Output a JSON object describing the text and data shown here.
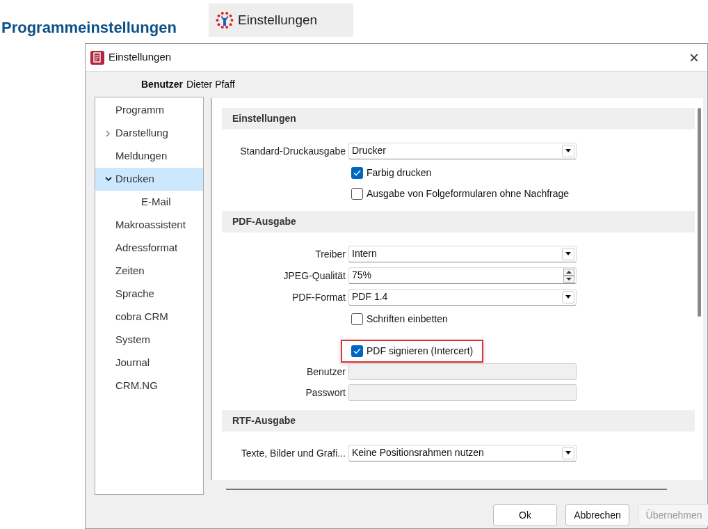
{
  "heading": "Programmeinstellungen",
  "toolbar_button": {
    "label": "Einstellungen"
  },
  "window": {
    "title": "Einstellungen",
    "close": "×"
  },
  "user": {
    "label": "Benutzer",
    "value": "Dieter Pfaff"
  },
  "sidebar": {
    "items": [
      {
        "label": "Programm",
        "kind": "item",
        "selected": false
      },
      {
        "label": "Darstellung",
        "kind": "group",
        "expanded": false,
        "selected": false
      },
      {
        "label": "Meldungen",
        "kind": "item",
        "selected": false
      },
      {
        "label": "Drucken",
        "kind": "group",
        "expanded": true,
        "selected": true,
        "children": [
          {
            "label": "E-Mail",
            "kind": "item",
            "selected": false
          }
        ]
      },
      {
        "label": "Makroassistent",
        "kind": "item",
        "selected": false
      },
      {
        "label": "Adressformat",
        "kind": "item",
        "selected": false
      },
      {
        "label": "Zeiten",
        "kind": "item",
        "selected": false
      },
      {
        "label": "Sprache",
        "kind": "item",
        "selected": false
      },
      {
        "label": "cobra CRM",
        "kind": "item",
        "selected": false
      },
      {
        "label": "System",
        "kind": "item",
        "selected": false
      },
      {
        "label": "Journal",
        "kind": "item",
        "selected": false
      },
      {
        "label": "CRM.NG",
        "kind": "item",
        "selected": false
      }
    ]
  },
  "sections": [
    {
      "title": "Einstellungen",
      "rows": [
        {
          "kind": "select",
          "label": "Standard-Druckausgabe",
          "value": "Drucker"
        },
        {
          "kind": "checkbox",
          "label": "Farbig drucken",
          "checked": true,
          "highlighted": false
        },
        {
          "kind": "checkbox",
          "label": "Ausgabe von Folgeformularen ohne Nachfrage",
          "checked": false,
          "highlighted": false
        }
      ]
    },
    {
      "title": "PDF-Ausgabe",
      "rows": [
        {
          "kind": "select",
          "label": "Treiber",
          "value": "Intern"
        },
        {
          "kind": "spinner",
          "label": "JPEG-Qualität",
          "value": "75%"
        },
        {
          "kind": "select",
          "label": "PDF-Format",
          "value": "PDF 1.4"
        },
        {
          "kind": "checkbox",
          "label": "Schriften einbetten",
          "checked": false,
          "highlighted": false
        },
        {
          "kind": "spacer"
        },
        {
          "kind": "checkbox",
          "label": "PDF signieren (Intercert)",
          "checked": true,
          "highlighted": true
        },
        {
          "kind": "text",
          "label": "Benutzer",
          "disabled": true
        },
        {
          "kind": "text",
          "label": "Passwort",
          "disabled": true
        }
      ]
    },
    {
      "title": "RTF-Ausgabe",
      "rows": [
        {
          "kind": "select",
          "label": "Texte, Bilder und Grafi...",
          "value": "Keine Positionsrahmen nutzen"
        }
      ]
    }
  ],
  "buttons": [
    {
      "label": "Ok",
      "disabled": false
    },
    {
      "label": "Abbrechen",
      "disabled": false
    },
    {
      "label": "Übernehmen",
      "disabled": true
    }
  ]
}
